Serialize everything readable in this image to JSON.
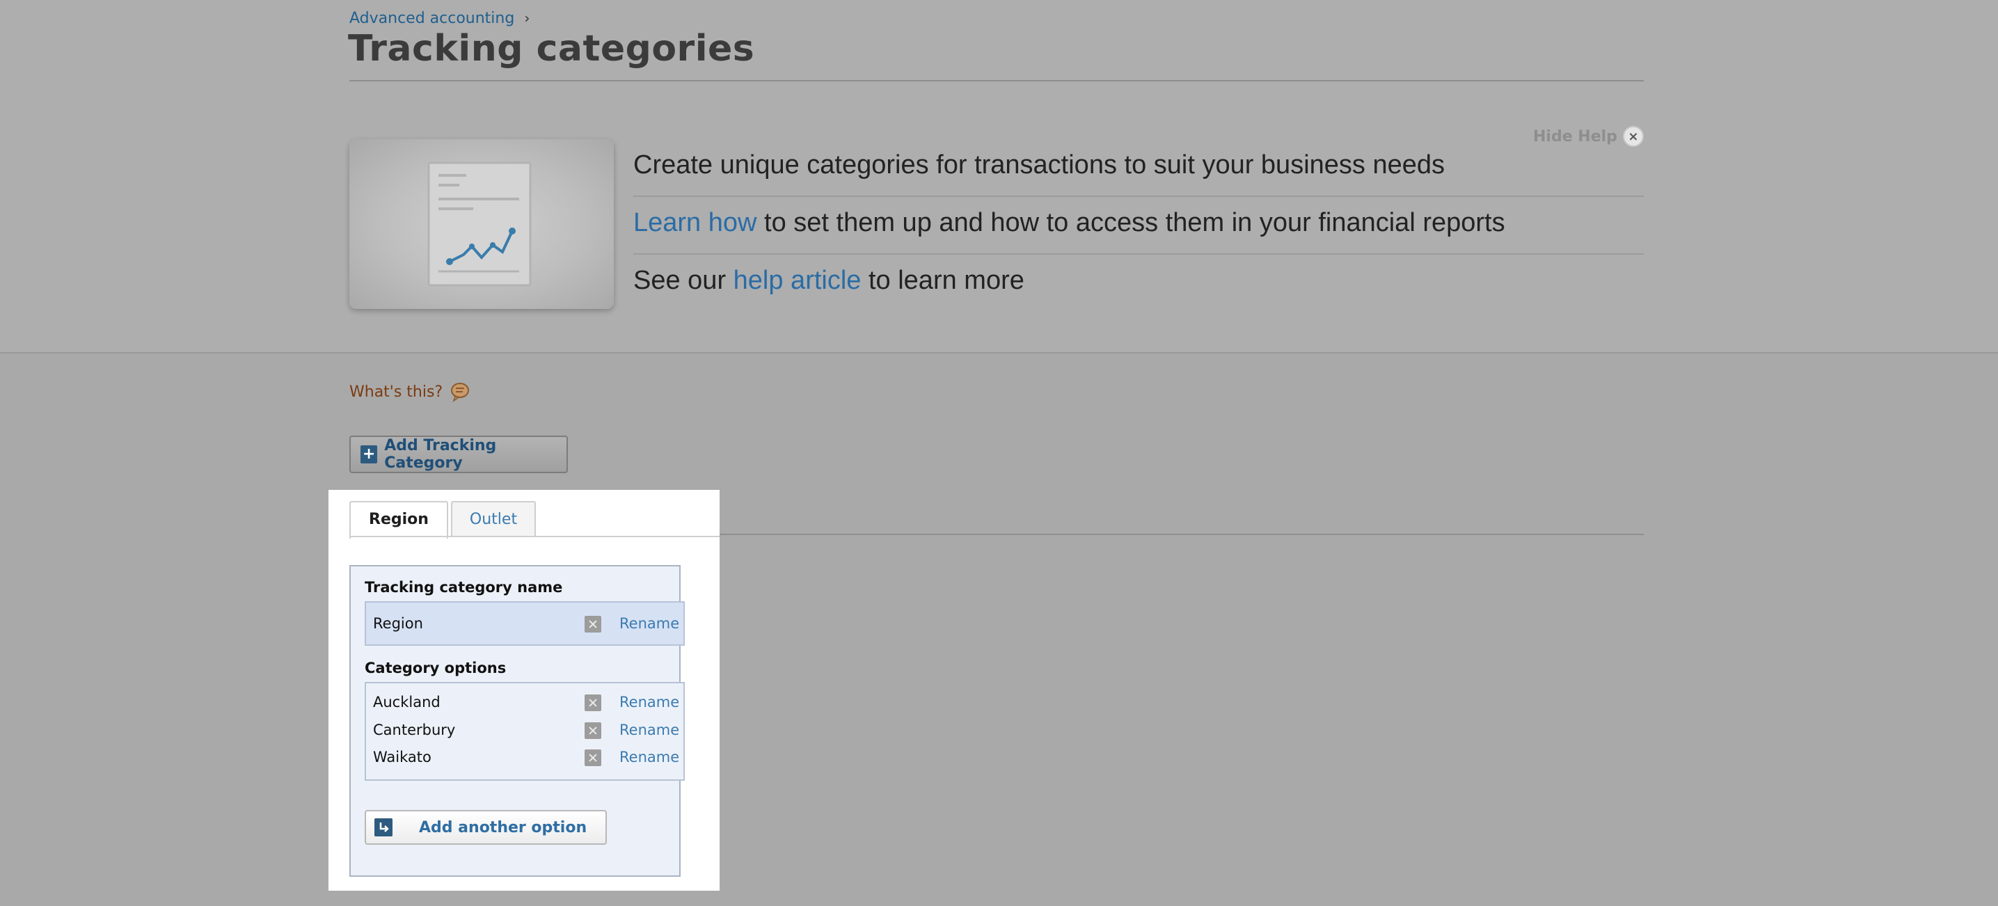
{
  "breadcrumb": {
    "parent": "Advanced accounting",
    "separator": "›"
  },
  "page": {
    "title": "Tracking categories"
  },
  "help": {
    "hide_label": "Hide Help",
    "close_glyph": "×",
    "line1": "Create unique categories for transactions to suit your business needs",
    "line2_link": "Learn how",
    "line2_rest": " to set them up and how to access them in your financial reports",
    "line3_pre": "See our ",
    "line3_link": "help article",
    "line3_post": " to learn more"
  },
  "whats_this": {
    "label": "What's this?",
    "icon": "speech-bubble-icon"
  },
  "add_category": {
    "label": "Add Tracking Category",
    "icon": "plus-icon"
  },
  "tabs": [
    {
      "label": "Region",
      "active": true
    },
    {
      "label": "Outlet",
      "active": false
    }
  ],
  "form": {
    "name_label": "Tracking category name",
    "name_value": "Region",
    "rename_label": "Rename",
    "options_label": "Category options",
    "options": [
      "Auckland",
      "Canterbury",
      "Waikato"
    ],
    "add_option_label": "Add another option",
    "add_option_icon": "enter-arrow-icon"
  },
  "colors": {
    "link": "#2a6ca5",
    "button_text": "#1f4f78",
    "whats_this": "#7a3b10",
    "form_bg": "#ecf1f9"
  }
}
